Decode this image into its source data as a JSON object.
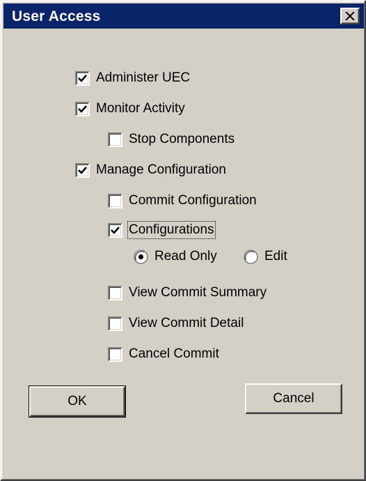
{
  "window": {
    "title": "User Access",
    "close_icon": "close-icon"
  },
  "checkboxes": {
    "administer_uec": {
      "label": "Administer UEC",
      "checked": true
    },
    "monitor_activity": {
      "label": "Monitor Activity",
      "checked": true
    },
    "stop_components": {
      "label": "Stop Components",
      "checked": false
    },
    "manage_configuration": {
      "label": "Manage Configuration",
      "checked": true
    },
    "commit_configuration": {
      "label": "Commit Configuration",
      "checked": false
    },
    "configurations": {
      "label": "Configurations",
      "checked": true
    },
    "view_commit_summary": {
      "label": "View Commit Summary",
      "checked": false
    },
    "view_commit_detail": {
      "label": "View Commit Detail",
      "checked": false
    },
    "cancel_commit": {
      "label": "Cancel Commit",
      "checked": false
    }
  },
  "configurations_mode": {
    "options": [
      {
        "label": "Read Only",
        "selected": true
      },
      {
        "label": "Edit",
        "selected": false
      }
    ]
  },
  "buttons": {
    "ok": "OK",
    "cancel": "Cancel"
  },
  "colors": {
    "titlebar": "#0a246a",
    "face": "#d4d0c8"
  }
}
